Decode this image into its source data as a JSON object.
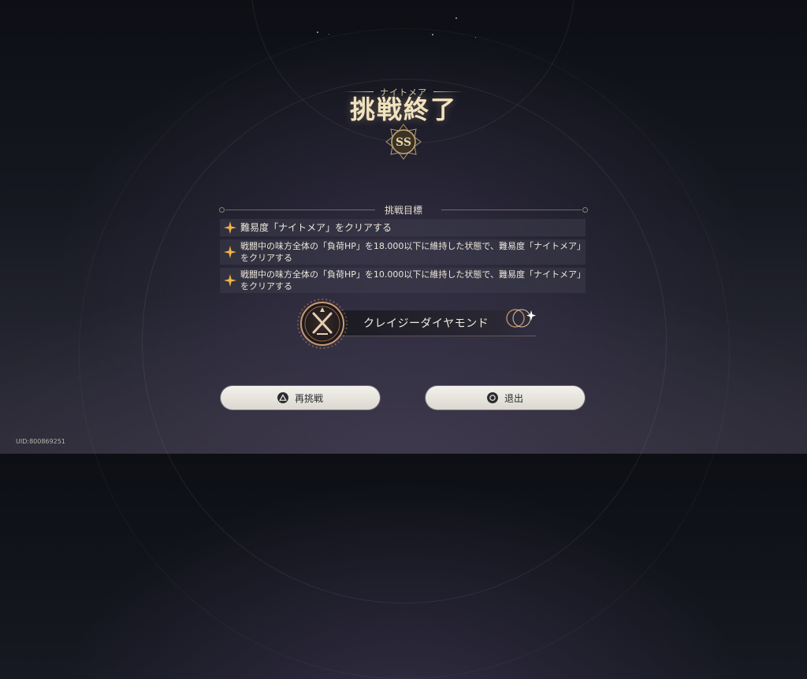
{
  "header": {
    "difficulty_label": "ナイトメア",
    "title": "挑戦終了",
    "rank": "SS"
  },
  "objectives": {
    "heading": "挑戦目標",
    "items": [
      {
        "text": "難易度「ナイトメア」をクリアする"
      },
      {
        "text": "戦闘中の味方全体の「負荷HP」を18.000以下に維持した状態で、難易度「ナイトメア」をクリアする"
      },
      {
        "text": "戦闘中の味方全体の「負荷HP」を10.000以下に維持した状態で、難易度「ナイトメア」をクリアする"
      }
    ]
  },
  "reward": {
    "name": "クレイジーダイヤモンド"
  },
  "buttons": {
    "retry": {
      "label": "再挑戦",
      "icon": "triangle-button-icon"
    },
    "exit": {
      "label": "退出",
      "icon": "circle-button-icon"
    }
  },
  "footer": {
    "uid": "UID:800869251"
  },
  "colors": {
    "accent_gold": "#f1e3bf",
    "button_bg": "#efece6",
    "background": "#161821"
  }
}
